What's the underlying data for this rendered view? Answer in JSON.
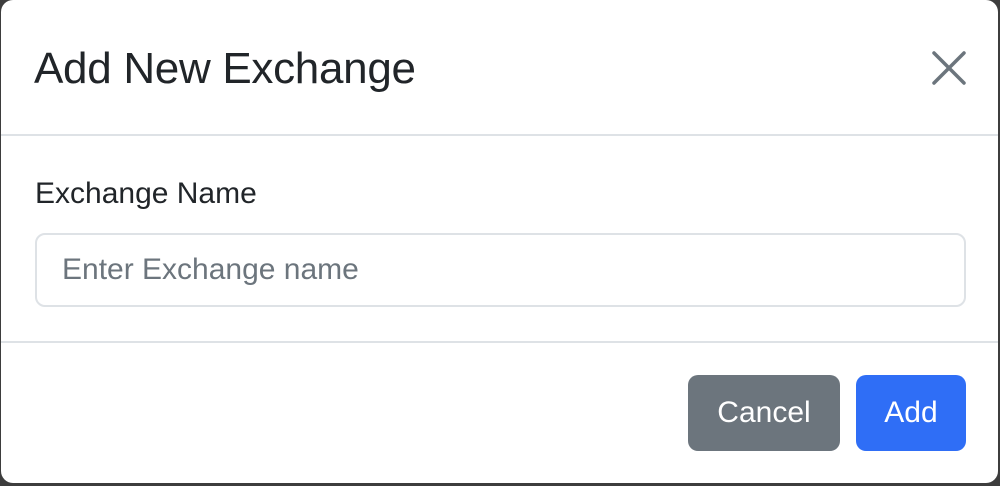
{
  "modal": {
    "title": "Add New Exchange",
    "close_icon": "close-icon"
  },
  "form": {
    "exchange_name": {
      "label": "Exchange Name",
      "value": "",
      "placeholder": "Enter Exchange name"
    }
  },
  "footer": {
    "cancel_label": "Cancel",
    "add_label": "Add"
  },
  "colors": {
    "primary": "#2f6ef6",
    "secondary": "#6c757d",
    "text": "#212529",
    "border": "#dee2e6"
  }
}
